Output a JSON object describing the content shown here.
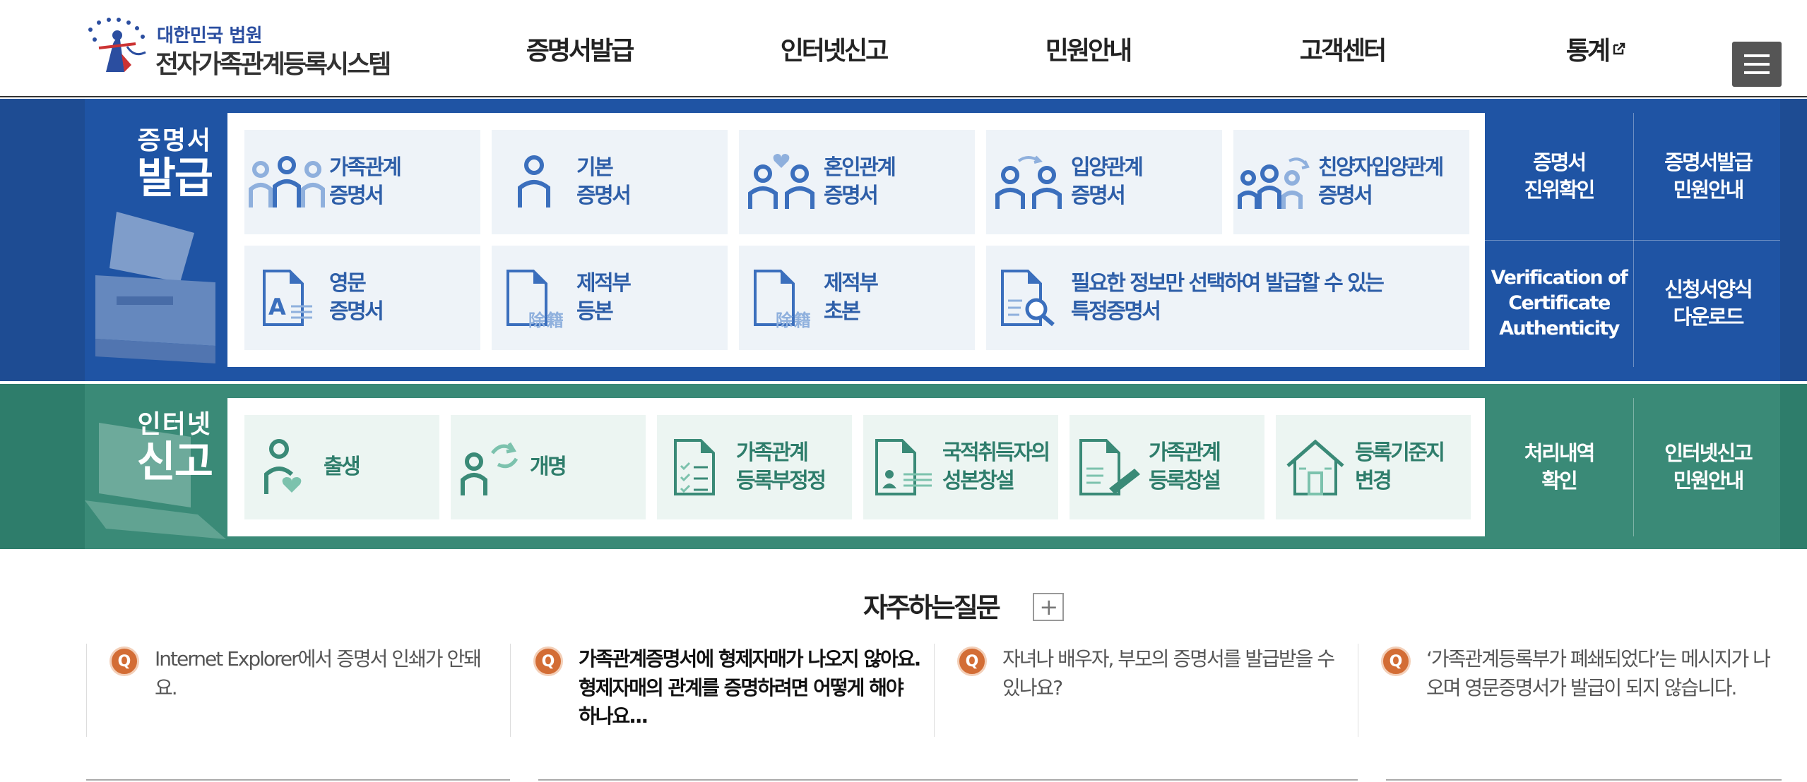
{
  "header": {
    "logo_court": "대한민국 법원",
    "logo_title": "전자가족관계등록시스템",
    "nav": [
      "증명서발급",
      "인터넷신고",
      "민원안내",
      "고객센터",
      "통계"
    ]
  },
  "cert": {
    "title_small": "증명서",
    "title_big": "발급",
    "tiles": [
      {
        "line1": "가족관계",
        "line2": "증명서",
        "icon": "family-icon"
      },
      {
        "line1": "기본",
        "line2": "증명서",
        "icon": "person-icon"
      },
      {
        "line1": "혼인관계",
        "line2": "증명서",
        "icon": "couple-heart-icon"
      },
      {
        "line1": "입양관계",
        "line2": "증명서",
        "icon": "adoption-icon"
      },
      {
        "line1": "친양자입양관계",
        "line2": "증명서",
        "icon": "family-cycle-icon"
      },
      {
        "line1": "영문",
        "line2": "증명서",
        "icon": "document-a-icon"
      },
      {
        "line1": "제적부",
        "line2": "등본",
        "icon": "document-removed-icon",
        "stamp": "除籍"
      },
      {
        "line1": "제적부",
        "line2": "초본",
        "icon": "document-removed-icon",
        "stamp": "除籍"
      },
      {
        "line1": "필요한 정보만 선택하여 발급할 수 있는",
        "line2": "특정증명서",
        "icon": "document-search-icon"
      }
    ],
    "quick": [
      {
        "line1": "증명서",
        "line2": "진위확인"
      },
      {
        "line1": "증명서발급",
        "line2": "민원안내"
      },
      {
        "line1": "Verification of",
        "line2": "Certificate",
        "line3": "Authenticity"
      },
      {
        "line1": "신청서양식",
        "line2": "다운로드"
      }
    ]
  },
  "report": {
    "title_small": "인터넷",
    "title_big": "신고",
    "tiles": [
      {
        "line1": "출생",
        "line2": "",
        "icon": "birth-icon"
      },
      {
        "line1": "개명",
        "line2": "",
        "icon": "rename-icon"
      },
      {
        "line1": "가족관계",
        "line2": "등록부정정",
        "icon": "checklist-icon"
      },
      {
        "line1": "국적취득자의",
        "line2": "성본창설",
        "icon": "id-document-icon"
      },
      {
        "line1": "가족관계",
        "line2": "등록창설",
        "icon": "document-pen-icon"
      },
      {
        "line1": "등록기준지",
        "line2": "변경",
        "icon": "house-icon"
      }
    ],
    "quick": [
      {
        "line1": "처리내역",
        "line2": "확인"
      },
      {
        "line1": "인터넷신고",
        "line2": "민원안내"
      }
    ]
  },
  "faq": {
    "title": "자주하는질문",
    "more": "+",
    "q_mark": "Q",
    "items": [
      {
        "text": "Internet Explorer에서 증명서 인쇄가 안돼요."
      },
      {
        "text": "가족관계증명서에 형제자매가 나오지 않아요. 형제자매의 관계를 증명하려면 어떻게 해야 하나요..."
      },
      {
        "text": "자녀나 배우자, 부모의 증명서를 발급받을 수 있나요?"
      },
      {
        "text": "‘가족관계등록부가 폐쇄되었다’는 메시지가 나오며 영문증명서가 발급이 되지 않습니다."
      }
    ]
  },
  "colors": {
    "cert_blue": "#1f54a4",
    "cert_text": "#2d5ea8",
    "report_green": "#3a8a77",
    "report_text": "#2e7d6b",
    "faq_orange": "#d36d35"
  }
}
